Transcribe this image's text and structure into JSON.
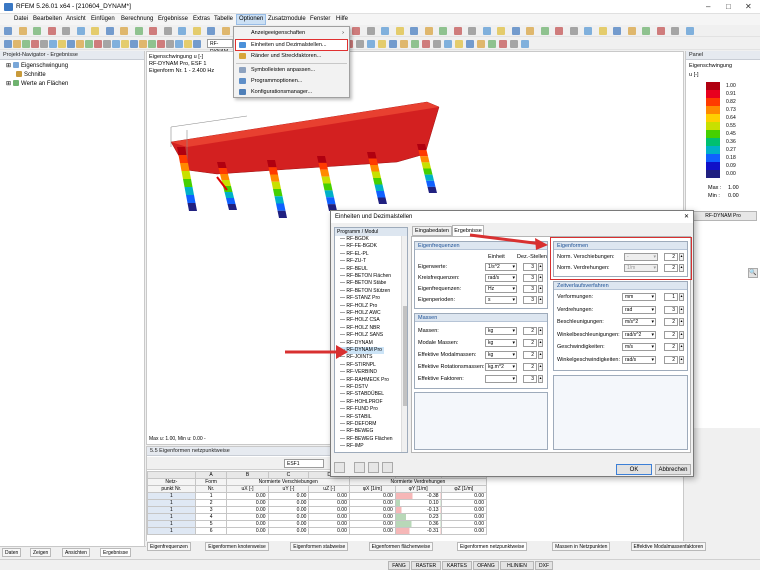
{
  "window": {
    "title": "RFEM 5.26.01 x64 - [210604_DYNAM*]"
  },
  "menu": [
    "Datei",
    "Bearbeiten",
    "Ansicht",
    "Einfügen",
    "Berechnung",
    "Ergebnisse",
    "Extras",
    "Tabelle",
    "Optionen",
    "Zusatzmodule",
    "Fenster",
    "Hilfe"
  ],
  "toolbar": {
    "module_combo": "RF-DYNAM"
  },
  "options_menu": {
    "items": [
      "Anzeigeeigenschaften",
      "Einheiten und Dezimalstellen...",
      "Ränder und Streckfaktoren...",
      "Symbolleisten anpassen...",
      "Programmoptionen...",
      "Konfigurationsmanager..."
    ]
  },
  "navigator": {
    "title": "Projekt-Navigator - Ergebnisse",
    "items": [
      "Eigenschwingung",
      "Schnitte",
      "Werte an Flächen"
    ],
    "tabs": [
      "Daten",
      "Zeigen",
      "Ansichten",
      "Ergebnisse"
    ]
  },
  "view": {
    "info_line1": "Eigenschwingung u [-]",
    "info_line2": "RF-DYNAM Pro, ESF 1",
    "info_line3": "Eigenform Nr. 1 - 2.400 Hz",
    "footer": "Max u: 1.00, Min u: 0.00 -"
  },
  "panel": {
    "title": "Panel",
    "subtitle1": "Eigenschwingung",
    "subtitle2": "u [-]",
    "scale_values": [
      "1.00",
      "0.91",
      "0.82",
      "0.73",
      "0.64",
      "0.55",
      "0.45",
      "0.36",
      "0.27",
      "0.18",
      "0.09",
      "0.00"
    ],
    "scale_colors": [
      "#b00010",
      "#e8001e",
      "#ff3a00",
      "#ff8a00",
      "#ffd000",
      "#c8e000",
      "#45d000",
      "#00c070",
      "#00b0c8",
      "#1060ff",
      "#1010c8",
      "#202080"
    ],
    "max_label": "Max :",
    "max_value": "1.00",
    "min_label": "Min :",
    "min_value": "0.00",
    "module": "RF-DYNAM Pro"
  },
  "dialog": {
    "title": "Einheiten und Dezimalstellen",
    "close": "✕",
    "tree_header": "Programm / Modul",
    "tree_items": [
      "RF-BGDK",
      "RF-FE-BGDK",
      "RF-EL-PL",
      "RF-ZU-T",
      "RF-BEUL",
      "RF-BETON Flächen",
      "RF-BETON Stäbe",
      "RF-BETON Stützen",
      "RF-STANZ Pro",
      "RF-HOLZ Pro",
      "RF-HOLZ AWC",
      "RF-HOLZ CSA",
      "RF-HOLZ NBR",
      "RF-HOLZ SANS",
      "RF-DYNAM",
      "RF-DYNAM Pro",
      "RF-JOINTS",
      "RF-STIRNPL",
      "RF-VERBIND",
      "RF-RAHMECK Pro",
      "RF-DSTV",
      "RF-STABDÜBEL",
      "RF-HOHLPROF",
      "RF-FUND Pro",
      "RF-STABIL",
      "RF-DEFORM",
      "RF-BEWEG",
      "RF-BEWEG Flächen",
      "RF-IMP"
    ],
    "tabs": [
      "Eingabedaten",
      "Ergebnisse"
    ],
    "eigenfreq": {
      "title": "Eigenfrequenzen",
      "col_unit": "Einheit",
      "col_dec": "Dez.-Stellen",
      "rows": [
        {
          "label": "Eigenwerte:",
          "unit": "1/s^2",
          "dec": "3"
        },
        {
          "label": "Kreisfrequenzen:",
          "unit": "rad/s",
          "dec": "3"
        },
        {
          "label": "Eigenfrequenzen:",
          "unit": "Hz",
          "dec": "3"
        },
        {
          "label": "Eigenperioden:",
          "unit": "s",
          "dec": "3"
        }
      ]
    },
    "massen": {
      "title": "Massen",
      "rows": [
        {
          "label": "Massen:",
          "unit": "kg",
          "dec": "2"
        },
        {
          "label": "Modale Massen:",
          "unit": "kg",
          "dec": "2"
        },
        {
          "label": "Effektive Modalmassen:",
          "unit": "kg",
          "dec": "2"
        },
        {
          "label": "Effektive Rotationsmassen:",
          "unit": "kg.m^2",
          "dec": "2"
        },
        {
          "label": "Effektive Faktoren:",
          "unit": "",
          "dec": "3"
        }
      ]
    },
    "eigenformen": {
      "title": "Eigenformen",
      "rows": [
        {
          "label": "Norm. Verschiebungen:",
          "unit": "-",
          "dec": "2"
        },
        {
          "label": "Norm. Verdrehungen:",
          "unit": "1/m",
          "dec": "2"
        }
      ]
    },
    "zeitverlauf": {
      "title": "Zeitverlaufsverfahren",
      "rows": [
        {
          "label": "Verformungen:",
          "unit": "mm",
          "dec": "1"
        },
        {
          "label": "Verdrehungen:",
          "unit": "rad",
          "dec": "3"
        },
        {
          "label": "Beschleunigungen:",
          "unit": "m/s^2",
          "dec": "2"
        },
        {
          "label": "Winkelbeschleunigungen:",
          "unit": "rad/s^2",
          "dec": "2"
        },
        {
          "label": "Geschwindigkeiten:",
          "unit": "m/s",
          "dec": "2"
        },
        {
          "label": "Winkelgeschwindigkeiten:",
          "unit": "rad/s",
          "dec": "2"
        }
      ]
    },
    "ok": "OK",
    "cancel": "Abbrechen"
  },
  "results": {
    "title": "5.5 Eigenformen netzpunktweise",
    "combo": "ESF1",
    "col_letters": [
      "A",
      "B",
      "C",
      "D",
      "E",
      "F",
      "G"
    ],
    "head1": [
      "Netz-",
      "Form",
      "Normierte Verschiebungen",
      "Normierte Verdrehungen"
    ],
    "head2": [
      "punkt Nr.",
      "Nr.",
      "uX [-]",
      "uY [-]",
      "uZ [-]",
      "φX [1/m]",
      "φY [1/m]",
      "φZ [1/m]"
    ],
    "rows": [
      [
        "1",
        "1",
        "0.00",
        "0.00",
        "0.00",
        "0.00",
        "-0.38",
        "0.00"
      ],
      [
        "1",
        "2",
        "0.00",
        "0.00",
        "0.00",
        "0.00",
        "0.10",
        "0.00"
      ],
      [
        "1",
        "3",
        "0.00",
        "0.00",
        "0.00",
        "0.00",
        "-0.13",
        "0.00"
      ],
      [
        "1",
        "4",
        "0.00",
        "0.00",
        "0.00",
        "0.00",
        "0.23",
        "0.00"
      ],
      [
        "1",
        "5",
        "0.00",
        "0.00",
        "0.00",
        "0.00",
        "0.36",
        "0.00"
      ],
      [
        "1",
        "6",
        "0.00",
        "0.00",
        "0.00",
        "0.00",
        "-0.31",
        "0.00"
      ]
    ],
    "tabs": [
      "Eigenfrequenzen",
      "Eigenformen knotenweise",
      "Eigenformen stabweise",
      "Eigenformen flächenweise",
      "Eigenformen netzpunktweise",
      "Massen in Netzpunkten",
      "Effektive Modalmassenfaktoren"
    ]
  },
  "statusbar": [
    "FANG",
    "RASTER",
    "KARTES",
    "OFANG",
    "HLINIEN",
    "DXF"
  ]
}
